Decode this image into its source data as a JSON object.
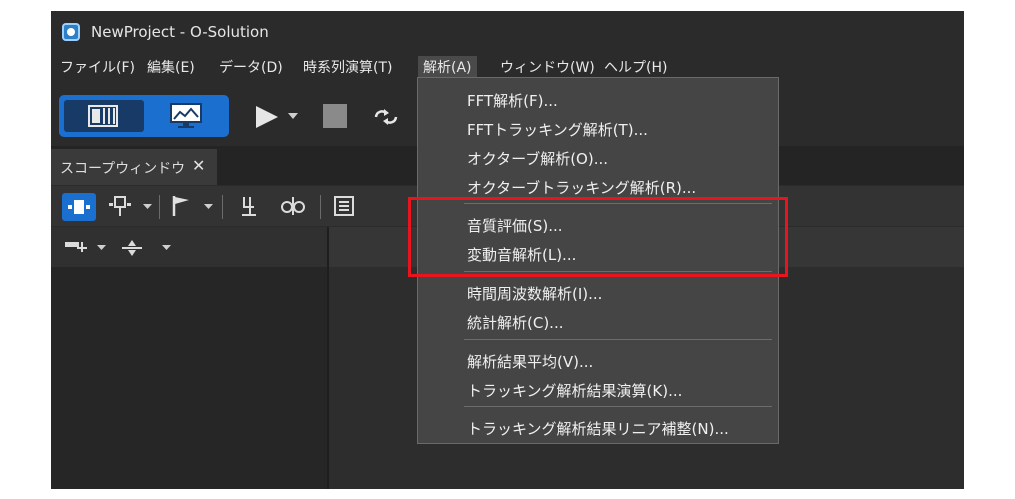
{
  "window": {
    "title": "NewProject - O-Solution"
  },
  "menubar": {
    "items": [
      {
        "label": "ファイル(F)"
      },
      {
        "label": "編集(E)"
      },
      {
        "label": "データ(D)"
      },
      {
        "label": "時系列演算(T)"
      },
      {
        "label": "解析(A)",
        "active": true
      },
      {
        "label": "ウィンドウ(W)"
      },
      {
        "label": "ヘルプ(H)"
      }
    ]
  },
  "tabs": [
    {
      "label": "スコープウィンドウ",
      "close": "✕"
    }
  ],
  "analysis_menu": {
    "items": [
      {
        "label": "FFT解析(F)..."
      },
      {
        "label": "FFTトラッキング解析(T)..."
      },
      {
        "label": "オクターブ解析(O)..."
      },
      {
        "label": "オクターブトラッキング解析(R)..."
      },
      {
        "label": "音質評価(S)..."
      },
      {
        "label": "変動音解析(L)..."
      },
      {
        "label": "時間周波数解析(I)..."
      },
      {
        "label": "統計解析(C)..."
      },
      {
        "label": "解析結果平均(V)..."
      },
      {
        "label": "トラッキング解析結果演算(K)..."
      },
      {
        "label": "トラッキング解析結果リニア補整(N)..."
      }
    ]
  },
  "colors": {
    "accent": "#1b6fce",
    "highlight_box": "#e8141e",
    "menu_bg": "#454545",
    "app_bg": "#2b2b2b"
  },
  "icons": [
    "app-icon",
    "panel-layout-icon",
    "monitor-icon",
    "play-icon",
    "stop-icon",
    "loop-icon",
    "select-cursor-icon",
    "cursor-icon",
    "flag-icon",
    "marker-icon",
    "link-icon",
    "list-icon",
    "plot-add-icon",
    "split-icon"
  ]
}
